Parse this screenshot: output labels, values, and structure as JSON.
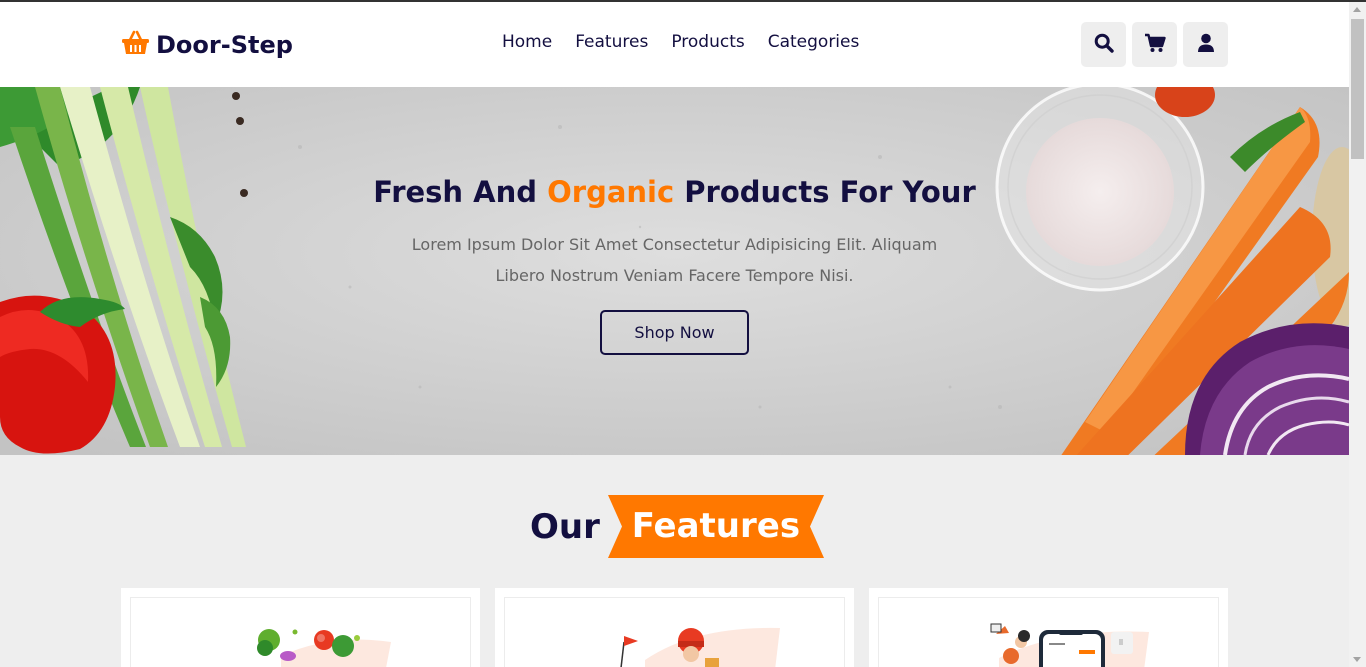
{
  "header": {
    "logo_text": "Door-Step",
    "logo_icon": "basket-icon",
    "nav": [
      {
        "label": "Home"
      },
      {
        "label": "Features"
      },
      {
        "label": "Products"
      },
      {
        "label": "Categories"
      }
    ],
    "icons": [
      "search-icon",
      "cart-icon",
      "user-icon"
    ]
  },
  "hero": {
    "title_part1": "Fresh And ",
    "title_accent": "Organic",
    "title_part2": " Products For Your",
    "description": "Lorem Ipsum Dolor Sit Amet Consectetur Adipisicing Elit. Aliquam Libero Nostrum Veniam Facere Tempore Nisi.",
    "button_label": "Shop Now"
  },
  "features": {
    "heading_plain": "Our",
    "heading_highlight": "Features"
  },
  "colors": {
    "brand_dark": "#130f40",
    "accent_orange": "#ff7800",
    "page_bg": "#eeeeee"
  }
}
